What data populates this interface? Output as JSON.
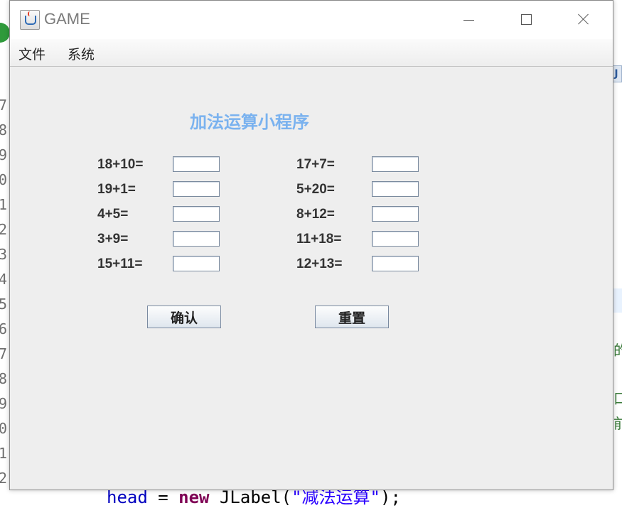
{
  "window": {
    "title": "GAME"
  },
  "menu": {
    "items": [
      "文件",
      "系统"
    ]
  },
  "app": {
    "heading": "加法运算小程序",
    "questions_left": [
      "18+10=",
      "19+1=",
      "4+5=",
      "3+9=",
      "15+11="
    ],
    "questions_right": [
      "17+7=",
      "5+20=",
      "8+12=",
      "11+18=",
      "12+13="
    ],
    "answers_left": [
      "",
      "",
      "",
      "",
      ""
    ],
    "answers_right": [
      "",
      "",
      "",
      "",
      ""
    ],
    "confirm_label": "确认",
    "reset_label": "重置"
  },
  "background": {
    "gutter_digits": [
      "7",
      "8",
      "9",
      "0",
      "1",
      "2",
      "3",
      "4",
      "5",
      "6",
      "7",
      "8",
      "9",
      "0",
      "1",
      "2"
    ],
    "right_edge_chars": [
      "的",
      "口",
      "前"
    ],
    "tab_letter": "J",
    "code_line": {
      "kw1": "head",
      "op": " = ",
      "kw2": "new",
      "rest": " JLabel(",
      "str": "\"减法运算\"",
      "end": ");"
    }
  },
  "colors": {
    "heading": "#7ab2ef",
    "window_bg": "#eeeeee",
    "accent_green": "#2f9a3b"
  }
}
